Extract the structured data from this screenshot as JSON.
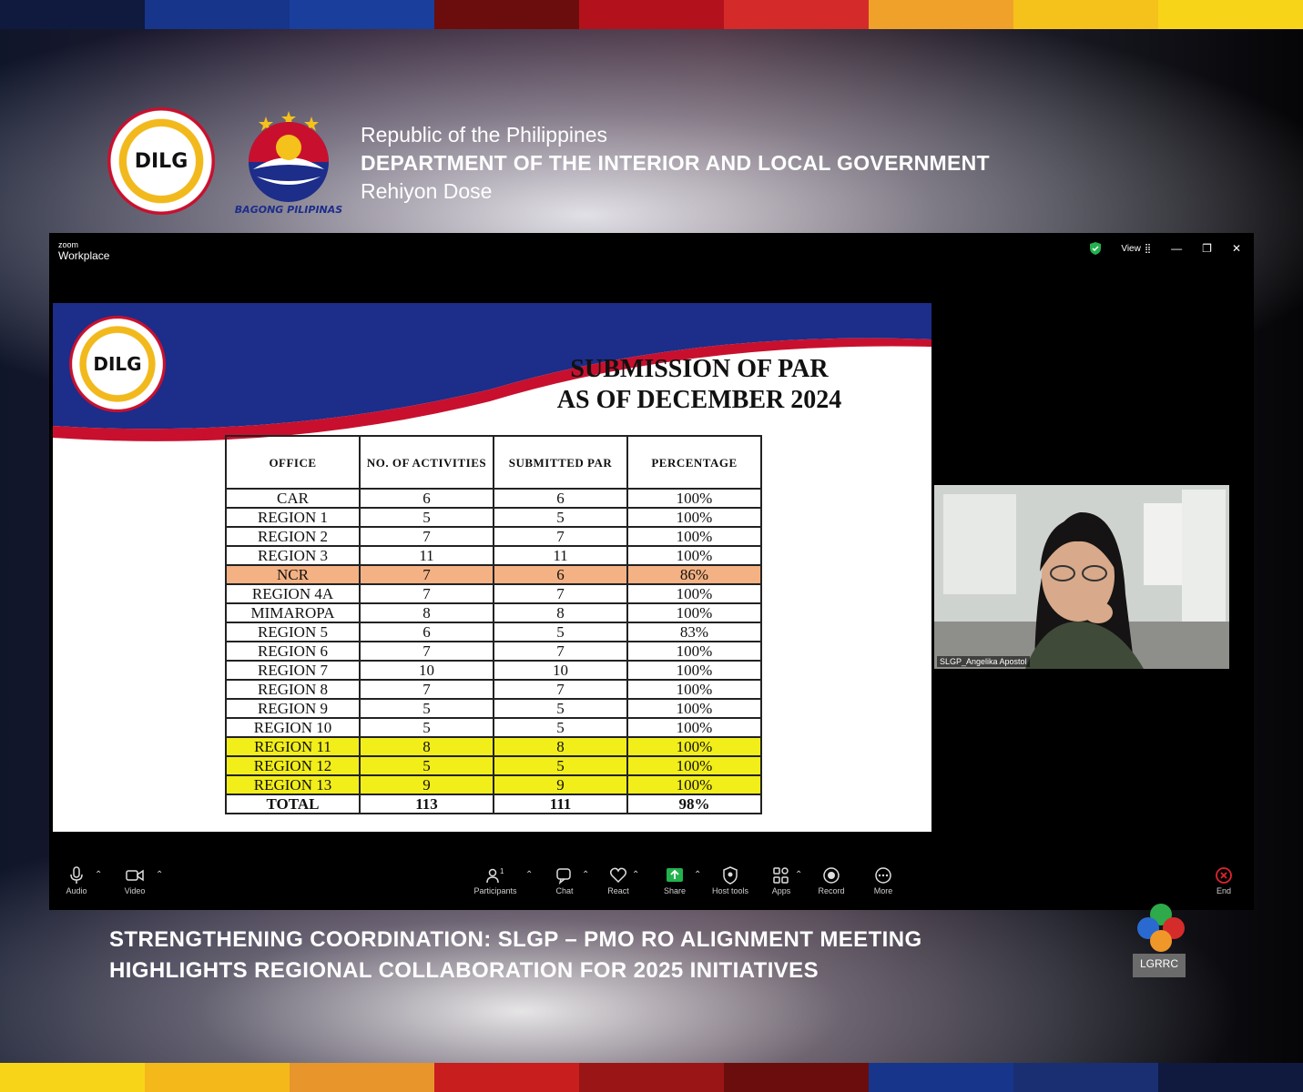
{
  "colors": {
    "stripe_top": [
      "#0f1a3e",
      "#17358a",
      "#1a3e9c",
      "#6b0d0d",
      "#b3121c",
      "#d42a2a",
      "#f0a12a",
      "#f4c21a",
      "#f7d417"
    ],
    "stripe_bottom": [
      "#f7d417",
      "#f4b81a",
      "#e8952c",
      "#c81e1e",
      "#9a1616",
      "#6b0d0d",
      "#17358a",
      "#1a2f72",
      "#0f1a3e"
    ],
    "dilg_red": "#c8102e",
    "dilg_blue": "#1c2d8a",
    "highlight_orange": "#f4b183",
    "highlight_yellow": "#f2ee1a"
  },
  "header": {
    "line1": "Republic of the Philippines",
    "line2": "DEPARTMENT OF THE INTERIOR AND LOCAL GOVERNMENT",
    "line3": "Rehiyon Dose",
    "seal_text": "DILG",
    "bagong_label": "BAGONG PILIPINAS"
  },
  "zoom": {
    "brand_small": "zoom",
    "brand": "Workplace",
    "view_label": "View",
    "participant_name": "SLGP_Angelika Apostol",
    "toolbar": {
      "audio": "Audio",
      "video": "Video",
      "participants": "Participants",
      "participants_count": "1",
      "chat": "Chat",
      "react": "React",
      "share": "Share",
      "host_tools": "Host tools",
      "apps": "Apps",
      "record": "Record",
      "more": "More",
      "end": "End"
    }
  },
  "slide": {
    "seal_text": "DILG",
    "title_line1": "SUBMISSION OF PAR",
    "title_line2": "AS OF DECEMBER 2024",
    "table": {
      "headers": [
        "OFFICE",
        "NO. OF ACTIVITIES",
        "SUBMITTED PAR",
        "PERCENTAGE"
      ],
      "rows": [
        {
          "office": "CAR",
          "activities": "6",
          "submitted": "6",
          "percentage": "100%",
          "highlight": ""
        },
        {
          "office": "REGION 1",
          "activities": "5",
          "submitted": "5",
          "percentage": "100%",
          "highlight": ""
        },
        {
          "office": "REGION 2",
          "activities": "7",
          "submitted": "7",
          "percentage": "100%",
          "highlight": ""
        },
        {
          "office": "REGION 3",
          "activities": "11",
          "submitted": "11",
          "percentage": "100%",
          "highlight": ""
        },
        {
          "office": "NCR",
          "activities": "7",
          "submitted": "6",
          "percentage": "86%",
          "highlight": "orange"
        },
        {
          "office": "REGION 4A",
          "activities": "7",
          "submitted": "7",
          "percentage": "100%",
          "highlight": ""
        },
        {
          "office": "MIMAROPA",
          "activities": "8",
          "submitted": "8",
          "percentage": "100%",
          "highlight": ""
        },
        {
          "office": "REGION 5",
          "activities": "6",
          "submitted": "5",
          "percentage": "83%",
          "highlight": ""
        },
        {
          "office": "REGION 6",
          "activities": "7",
          "submitted": "7",
          "percentage": "100%",
          "highlight": ""
        },
        {
          "office": "REGION 7",
          "activities": "10",
          "submitted": "10",
          "percentage": "100%",
          "highlight": ""
        },
        {
          "office": "REGION 8",
          "activities": "7",
          "submitted": "7",
          "percentage": "100%",
          "highlight": ""
        },
        {
          "office": "REGION 9",
          "activities": "5",
          "submitted": "5",
          "percentage": "100%",
          "highlight": ""
        },
        {
          "office": "REGION 10",
          "activities": "5",
          "submitted": "5",
          "percentage": "100%",
          "highlight": ""
        },
        {
          "office": "REGION 11",
          "activities": "8",
          "submitted": "8",
          "percentage": "100%",
          "highlight": "yellow"
        },
        {
          "office": "REGION 12",
          "activities": "5",
          "submitted": "5",
          "percentage": "100%",
          "highlight": "yellow"
        },
        {
          "office": "REGION 13",
          "activities": "9",
          "submitted": "9",
          "percentage": "100%",
          "highlight": "yellow"
        }
      ],
      "total": {
        "office": "TOTAL",
        "activities": "113",
        "submitted": "111",
        "percentage": "98%"
      }
    }
  },
  "caption": {
    "line1": "STRENGTHENING COORDINATION: SLGP – PMO RO ALIGNMENT MEETING",
    "line2": "HIGHLIGHTS REGIONAL COLLABORATION FOR 2025 INITIATIVES"
  },
  "lgrrc_label": "LGRRC"
}
